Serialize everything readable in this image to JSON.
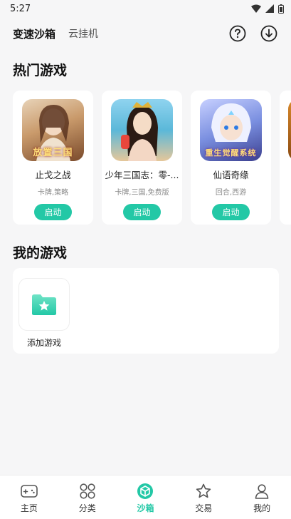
{
  "status": {
    "time": "5:27"
  },
  "header": {
    "active_tab": "变速沙箱",
    "tab2": "云挂机",
    "help_icon": "help-icon",
    "download_icon": "download-icon"
  },
  "hot_games": {
    "title": "热门游戏",
    "items": [
      {
        "name": "止戈之战",
        "tags": "卡牌,策略",
        "button": "启动",
        "cover_text": "放置三国",
        "color": "#c99a6b"
      },
      {
        "name": "少年三国志：零-...",
        "tags": "卡牌,三国,免费版",
        "button": "启动",
        "cover_text": "",
        "color": "#5bb8d9"
      },
      {
        "name": "仙语奇缘",
        "tags": "回合,西游",
        "button": "启动",
        "cover_text": "重生觉醒系统",
        "color": "#7a8fe0"
      }
    ]
  },
  "my_games": {
    "title": "我的游戏",
    "add_label": "添加游戏"
  },
  "bottom_nav": {
    "items": [
      {
        "label": "主页",
        "icon": "gamepad-icon"
      },
      {
        "label": "分类",
        "icon": "category-icon"
      },
      {
        "label": "沙箱",
        "icon": "sandbox-icon"
      },
      {
        "label": "交易",
        "icon": "star-icon"
      },
      {
        "label": "我的",
        "icon": "user-icon"
      }
    ],
    "active_index": 2,
    "accent": "#23c8a6"
  }
}
